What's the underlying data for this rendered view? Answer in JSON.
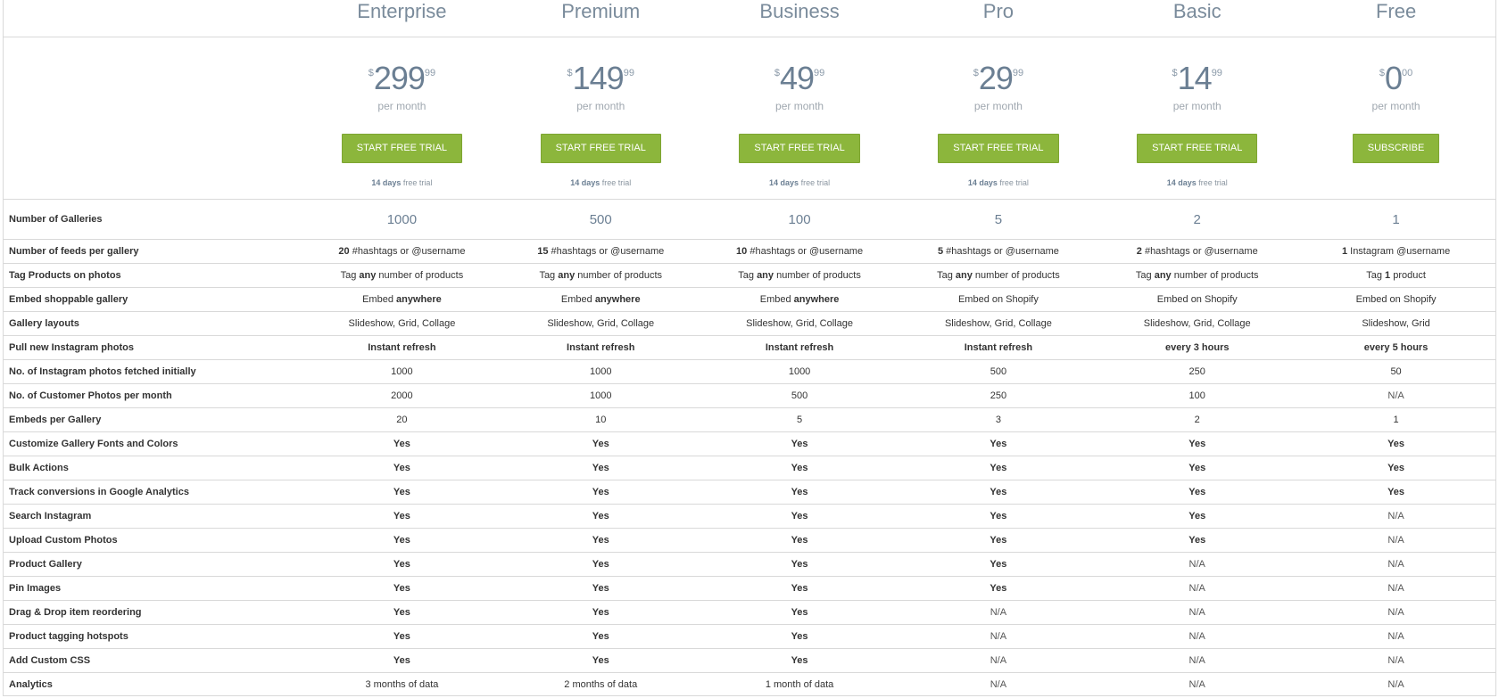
{
  "plans": [
    {
      "name": "Enterprise",
      "currency": "$",
      "amount": "299",
      "cents": "99",
      "period": "per month",
      "button": "START FREE TRIAL",
      "trial_bold": "14 days",
      "trial_rest": "free trial"
    },
    {
      "name": "Premium",
      "currency": "$",
      "amount": "149",
      "cents": "99",
      "period": "per month",
      "button": "START FREE TRIAL",
      "trial_bold": "14 days",
      "trial_rest": "free trial"
    },
    {
      "name": "Business",
      "currency": "$",
      "amount": "49",
      "cents": "99",
      "period": "per month",
      "button": "START FREE TRIAL",
      "trial_bold": "14 days",
      "trial_rest": "free trial"
    },
    {
      "name": "Pro",
      "currency": "$",
      "amount": "29",
      "cents": "99",
      "period": "per month",
      "button": "START FREE TRIAL",
      "trial_bold": "14 days",
      "trial_rest": "free trial"
    },
    {
      "name": "Basic",
      "currency": "$",
      "amount": "14",
      "cents": "99",
      "period": "per month",
      "button": "START FREE TRIAL",
      "trial_bold": "14 days",
      "trial_rest": "free trial"
    },
    {
      "name": "Free",
      "currency": "$",
      "amount": "0",
      "cents": "00",
      "period": "per month",
      "button": "SUBSCRIBE",
      "trial_bold": "",
      "trial_rest": ""
    }
  ],
  "galleries": {
    "label": "Number of Galleries",
    "values": [
      "1000",
      "500",
      "100",
      "5",
      "2",
      "1"
    ]
  },
  "features": [
    {
      "label": "Number of feeds per gallery",
      "cells": [
        {
          "b": "20",
          "t": " #hashtags or @username"
        },
        {
          "b": "15",
          "t": " #hashtags or @username"
        },
        {
          "b": "10",
          "t": " #hashtags or @username"
        },
        {
          "b": "5",
          "t": " #hashtags or @username"
        },
        {
          "b": "2",
          "t": " #hashtags or @username"
        },
        {
          "b": "1",
          "t": " Instagram @username"
        }
      ]
    },
    {
      "label": "Tag Products on photos",
      "cells": [
        {
          "p": "Tag ",
          "b": "any",
          "t": " number of products"
        },
        {
          "p": "Tag ",
          "b": "any",
          "t": " number of products"
        },
        {
          "p": "Tag ",
          "b": "any",
          "t": " number of products"
        },
        {
          "p": "Tag ",
          "b": "any",
          "t": " number of products"
        },
        {
          "p": "Tag ",
          "b": "any",
          "t": " number of products"
        },
        {
          "p": "Tag ",
          "b": "1",
          "t": " product"
        }
      ]
    },
    {
      "label": "Embed shoppable gallery",
      "cells": [
        {
          "p": "Embed ",
          "b": "anywhere"
        },
        {
          "p": "Embed ",
          "b": "anywhere"
        },
        {
          "p": "Embed ",
          "b": "anywhere"
        },
        {
          "t": "Embed on Shopify"
        },
        {
          "t": "Embed on Shopify"
        },
        {
          "t": "Embed on Shopify"
        }
      ]
    },
    {
      "label": "Gallery layouts",
      "cells": [
        {
          "t": "Slideshow, Grid, Collage"
        },
        {
          "t": "Slideshow, Grid, Collage"
        },
        {
          "t": "Slideshow, Grid, Collage"
        },
        {
          "t": "Slideshow, Grid, Collage"
        },
        {
          "t": "Slideshow, Grid, Collage"
        },
        {
          "t": "Slideshow, Grid"
        }
      ]
    },
    {
      "label": "Pull new Instagram photos",
      "cells": [
        {
          "b": "Instant refresh"
        },
        {
          "b": "Instant refresh"
        },
        {
          "b": "Instant refresh"
        },
        {
          "b": "Instant refresh"
        },
        {
          "b": "every 3 hours"
        },
        {
          "b": "every 5 hours"
        }
      ]
    },
    {
      "label": "No. of Instagram photos fetched initially",
      "cells": [
        {
          "t": "1000"
        },
        {
          "t": "1000"
        },
        {
          "t": "1000"
        },
        {
          "t": "500"
        },
        {
          "t": "250"
        },
        {
          "t": "50"
        }
      ]
    },
    {
      "label": "No. of Customer Photos per month",
      "cells": [
        {
          "t": "2000"
        },
        {
          "t": "1000"
        },
        {
          "t": "500"
        },
        {
          "t": "250"
        },
        {
          "t": "100"
        },
        {
          "t": "N/A"
        }
      ]
    },
    {
      "label": "Embeds per Gallery",
      "cells": [
        {
          "t": "20"
        },
        {
          "t": "10"
        },
        {
          "t": "5"
        },
        {
          "t": "3"
        },
        {
          "t": "2"
        },
        {
          "t": "1"
        }
      ]
    },
    {
      "label": "Customize Gallery Fonts and Colors",
      "cells": [
        {
          "b": "Yes"
        },
        {
          "b": "Yes"
        },
        {
          "b": "Yes"
        },
        {
          "b": "Yes"
        },
        {
          "b": "Yes"
        },
        {
          "b": "Yes"
        }
      ]
    },
    {
      "label": "Bulk Actions",
      "cells": [
        {
          "b": "Yes"
        },
        {
          "b": "Yes"
        },
        {
          "b": "Yes"
        },
        {
          "b": "Yes"
        },
        {
          "b": "Yes"
        },
        {
          "b": "Yes"
        }
      ]
    },
    {
      "label": "Track conversions in Google Analytics",
      "cells": [
        {
          "b": "Yes"
        },
        {
          "b": "Yes"
        },
        {
          "b": "Yes"
        },
        {
          "b": "Yes"
        },
        {
          "b": "Yes"
        },
        {
          "b": "Yes"
        }
      ]
    },
    {
      "label": "Search Instagram",
      "cells": [
        {
          "b": "Yes"
        },
        {
          "b": "Yes"
        },
        {
          "b": "Yes"
        },
        {
          "b": "Yes"
        },
        {
          "b": "Yes"
        },
        {
          "t": "N/A"
        }
      ]
    },
    {
      "label": "Upload Custom Photos",
      "cells": [
        {
          "b": "Yes"
        },
        {
          "b": "Yes"
        },
        {
          "b": "Yes"
        },
        {
          "b": "Yes"
        },
        {
          "b": "Yes"
        },
        {
          "t": "N/A"
        }
      ]
    },
    {
      "label": "Product Gallery",
      "cells": [
        {
          "b": "Yes"
        },
        {
          "b": "Yes"
        },
        {
          "b": "Yes"
        },
        {
          "b": "Yes"
        },
        {
          "t": "N/A"
        },
        {
          "t": "N/A"
        }
      ]
    },
    {
      "label": "Pin Images",
      "cells": [
        {
          "b": "Yes"
        },
        {
          "b": "Yes"
        },
        {
          "b": "Yes"
        },
        {
          "b": "Yes"
        },
        {
          "t": "N/A"
        },
        {
          "t": "N/A"
        }
      ]
    },
    {
      "label": "Drag & Drop item reordering",
      "cells": [
        {
          "b": "Yes"
        },
        {
          "b": "Yes"
        },
        {
          "b": "Yes"
        },
        {
          "t": "N/A"
        },
        {
          "t": "N/A"
        },
        {
          "t": "N/A"
        }
      ]
    },
    {
      "label": "Product tagging hotspots",
      "cells": [
        {
          "b": "Yes"
        },
        {
          "b": "Yes"
        },
        {
          "b": "Yes"
        },
        {
          "t": "N/A"
        },
        {
          "t": "N/A"
        },
        {
          "t": "N/A"
        }
      ]
    },
    {
      "label": "Add Custom CSS",
      "cells": [
        {
          "b": "Yes"
        },
        {
          "b": "Yes"
        },
        {
          "b": "Yes"
        },
        {
          "t": "N/A"
        },
        {
          "t": "N/A"
        },
        {
          "t": "N/A"
        }
      ]
    },
    {
      "label": "Analytics",
      "cells": [
        {
          "t": "3 months of data"
        },
        {
          "t": "2 months of data"
        },
        {
          "t": "1 month of data"
        },
        {
          "t": "N/A"
        },
        {
          "t": "N/A"
        },
        {
          "t": "N/A"
        }
      ]
    }
  ],
  "colors": {
    "accent": "#8cb63c",
    "heading": "#7a8b9b",
    "border": "#d9d9d9"
  }
}
